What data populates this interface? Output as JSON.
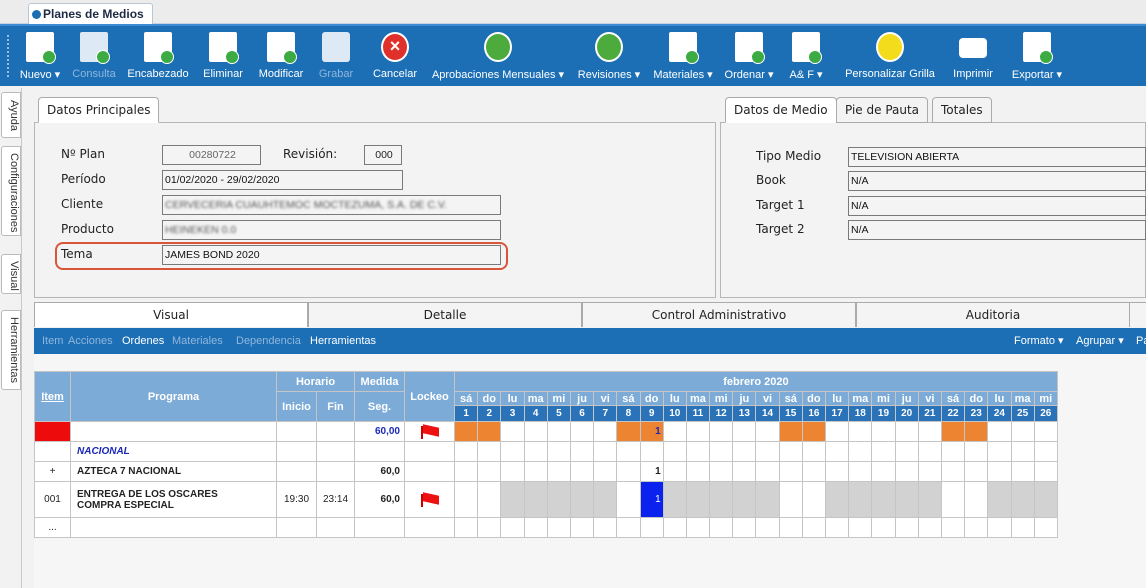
{
  "window": {
    "tab_title": "Planes de Medios"
  },
  "toolbar": {
    "nuevo": "Nuevo ▾",
    "consulta": "Consulta",
    "encabezado": "Encabezado",
    "eliminar": "Eliminar",
    "modificar": "Modificar",
    "grabar": "Grabar",
    "cancelar": "Cancelar",
    "aprobaciones": "Aprobaciones Mensuales ▾",
    "revisiones": "Revisiones ▾",
    "materiales": "Materiales ▾",
    "ordenar": "Ordenar ▾",
    "ayf": "A& F ▾",
    "personalizar": "Personalizar Grilla",
    "imprimir": "Imprimir",
    "exportar": "Exportar ▾"
  },
  "sidebar": {
    "ayuda": "Ayuda",
    "configuraciones": "Configuraciones",
    "visual": "Visual",
    "herramientas": "Herramientas"
  },
  "datos_principales": {
    "tab": "Datos Principales",
    "plan_label": "Nº Plan",
    "plan_value": "00280722",
    "revision_label": "Revisión:",
    "revision_value": "000",
    "periodo_label": "Período",
    "periodo_value": "01/02/2020 - 29/02/2020",
    "cliente_label": "Cliente",
    "cliente_value": "CERVECERIA CUAUHTEMOC MOCTEZUMA, S.A. DE C.V.",
    "producto_label": "Producto",
    "producto_value": "HEINEKEN 0.0",
    "tema_label": "Tema",
    "tema_value": "JAMES BOND 2020"
  },
  "datos_medio": {
    "tabs": [
      "Datos de Medio",
      "Pie de Pauta",
      "Totales"
    ],
    "tipo_label": "Tipo Medio",
    "tipo_value": "TELEVISION ABIERTA",
    "book_label": "Book",
    "book_value": "N/A",
    "target1_label": "Target 1",
    "target1_value": "N/A",
    "target2_label": "Target 2",
    "target2_value": "N/A"
  },
  "main_tabs": [
    "Visual",
    "Detalle",
    "Control Administrativo",
    "Auditoria"
  ],
  "subbar": {
    "items": [
      "Item",
      "Acciones",
      "Ordenes",
      "Materiales",
      "Dependencia",
      "Herramientas"
    ],
    "right": [
      "Formato ▾",
      "Agrupar ▾",
      "Pa"
    ]
  },
  "grid": {
    "headers": {
      "item": "Item",
      "programa": "Programa",
      "horario": "Horario",
      "inicio": "Inicio",
      "fin": "Fin",
      "medida": "Medida",
      "seg": "Seg.",
      "lockeo": "Lockeo",
      "month": "febrero 2020"
    },
    "days": [
      "sá",
      "do",
      "lu",
      "ma",
      "mi",
      "ju",
      "vi",
      "sá",
      "do",
      "lu",
      "ma",
      "mi",
      "ju",
      "vi",
      "sá",
      "do",
      "lu",
      "ma",
      "mi",
      "ju",
      "vi",
      "sá",
      "do",
      "lu",
      "ma",
      "mi"
    ],
    "dates": [
      "1",
      "2",
      "3",
      "4",
      "5",
      "6",
      "7",
      "8",
      "9",
      "10",
      "11",
      "12",
      "13",
      "14",
      "15",
      "16",
      "17",
      "18",
      "19",
      "20",
      "21",
      "22",
      "23",
      "24",
      "25",
      "26"
    ],
    "rows": [
      {
        "item": "",
        "programa": "",
        "inicio": "",
        "fin": "",
        "seg": "60,00",
        "lockeo": "flag",
        "cell9": "1"
      },
      {
        "item": "",
        "programa": "NACIONAL"
      },
      {
        "item": "+",
        "programa": "AZTECA 7 NACIONAL",
        "seg": "60,0",
        "cell9": "1"
      },
      {
        "item": "001",
        "programa": "ENTREGA DE LOS OSCARES",
        "programa2": "COMPRA ESPECIAL",
        "inicio": "19:30",
        "fin": "23:14",
        "seg": "60,0",
        "lockeo": "flag",
        "cell9": "1"
      },
      {
        "item": "..."
      }
    ]
  },
  "colors": {
    "toolbar": "#1d6fb5",
    "header": "#7cabd8",
    "weekend": "#ec8432",
    "selected": "#0b22ee",
    "highlight": "#d9553a"
  }
}
